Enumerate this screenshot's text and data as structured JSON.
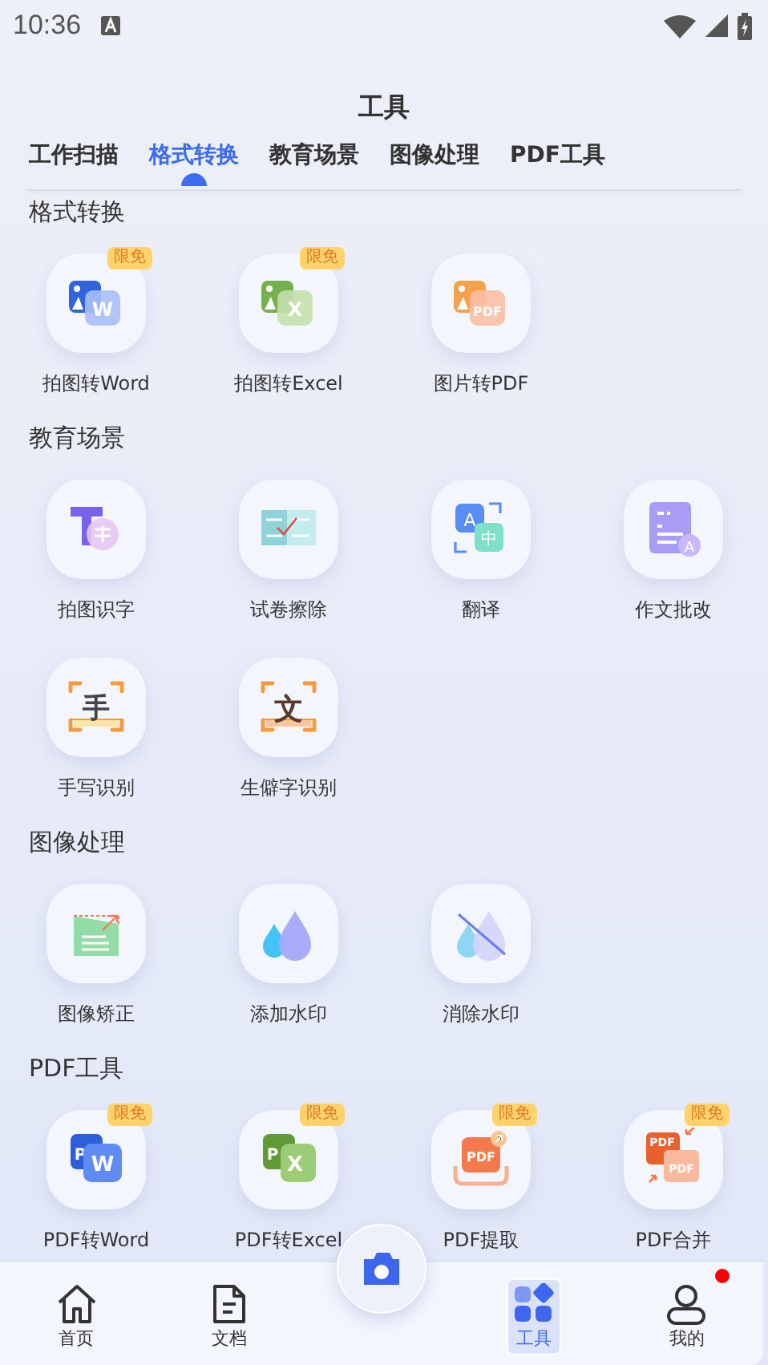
{
  "status_bar": {
    "time": "10:36"
  },
  "title": "工具",
  "tabs": [
    {
      "label": "工作扫描",
      "selected": false
    },
    {
      "label": "格式转换",
      "selected": true
    },
    {
      "label": "教育场景",
      "selected": false
    },
    {
      "label": "图像处理",
      "selected": false
    },
    {
      "label": "PDF工具",
      "selected": false
    }
  ],
  "sections": [
    {
      "title": "格式转换",
      "tools": [
        {
          "label": "拍图转Word",
          "badge": "限免",
          "kind": "imgword",
          "glyphs": [
            "W"
          ]
        },
        {
          "label": "拍图转Excel",
          "badge": "限免",
          "kind": "imgexcel",
          "glyphs": [
            "X"
          ]
        },
        {
          "label": "图片转PDF",
          "kind": "imgpdf",
          "glyphs": [
            "PDF"
          ]
        }
      ]
    },
    {
      "title": "教育场景",
      "tools": [
        {
          "label": "拍图识字",
          "kind": "textscan"
        },
        {
          "label": "试卷擦除",
          "kind": "erase"
        },
        {
          "label": "翻译",
          "kind": "translate",
          "glyphs": [
            "A",
            "中"
          ]
        },
        {
          "label": "作文批改",
          "kind": "essay",
          "glyphs": [
            "A"
          ]
        },
        {
          "label": "手写识别",
          "kind": "handwrite",
          "glyphs": [
            "手"
          ]
        },
        {
          "label": "生僻字识别",
          "kind": "rareword",
          "glyphs": [
            "文"
          ]
        }
      ]
    },
    {
      "title": "图像处理",
      "tools": [
        {
          "label": "图像矫正",
          "kind": "correct"
        },
        {
          "label": "添加水印",
          "kind": "watermark"
        },
        {
          "label": "消除水印",
          "kind": "unwatermark"
        }
      ]
    },
    {
      "title": "PDF工具",
      "tools": [
        {
          "label": "PDF转Word",
          "badge": "限免",
          "kind": "pdfword",
          "glyphs": [
            "P",
            "W"
          ]
        },
        {
          "label": "PDF转Excel",
          "badge": "限免",
          "kind": "pdfexcel",
          "glyphs": [
            "P",
            "X"
          ]
        },
        {
          "label": "PDF提取",
          "badge": "限免",
          "kind": "pdfextract",
          "glyphs": [
            "PDF"
          ]
        },
        {
          "label": "PDF合并",
          "badge": "限免",
          "kind": "pdfmerge",
          "glyphs": [
            "PDF",
            "PDF"
          ]
        }
      ]
    }
  ],
  "nav": [
    {
      "label": "首页",
      "kind": "home",
      "selected": false
    },
    {
      "label": "文档",
      "kind": "docs",
      "selected": false
    },
    {
      "kind": "camera",
      "selected": false
    },
    {
      "label": "工具",
      "kind": "tools",
      "selected": true
    },
    {
      "label": "我的",
      "kind": "me",
      "selected": false,
      "dot": true
    }
  ]
}
